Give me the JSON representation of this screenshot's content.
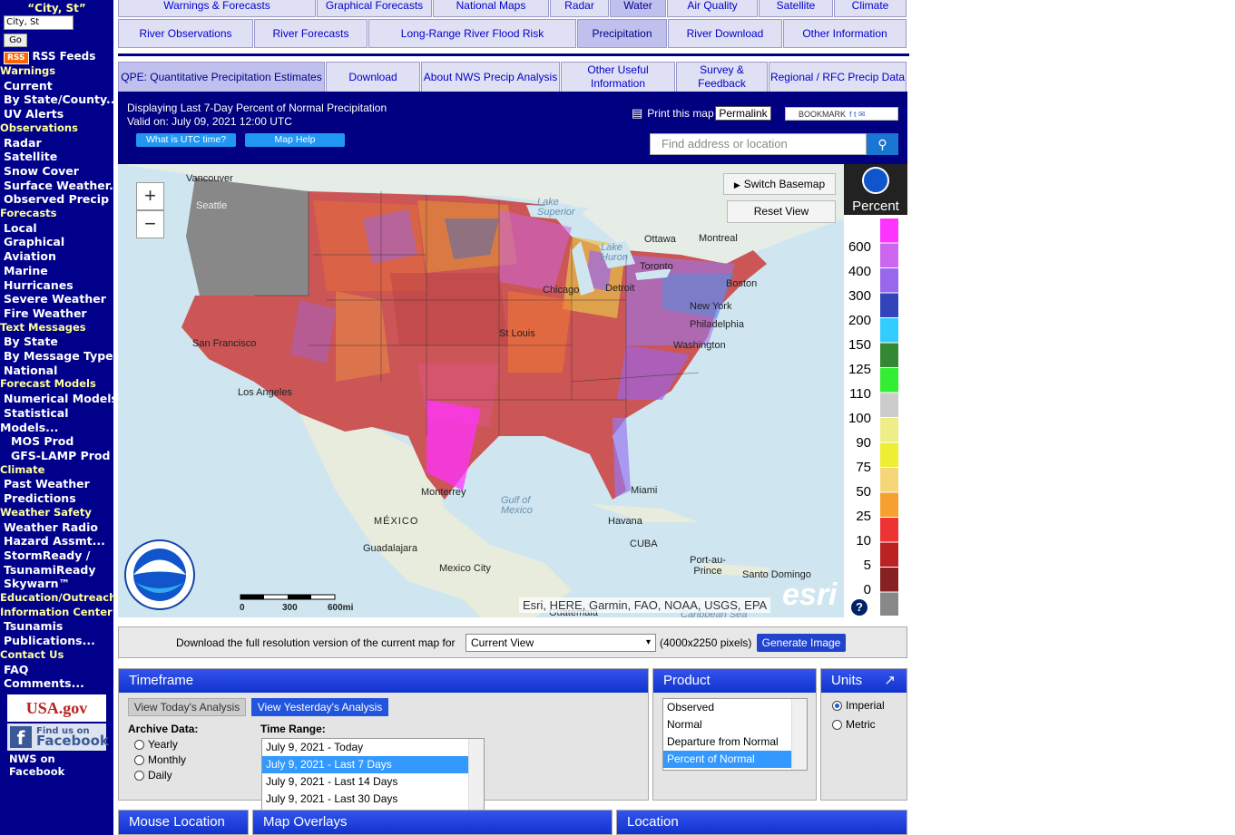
{
  "sidebar": {
    "location_title": "“City, St”",
    "location_value": "City, St",
    "go_label": "Go",
    "rss_badge": "RSS",
    "rss_label": "RSS Feeds",
    "menu": [
      {
        "type": "sec",
        "label": "Warnings"
      },
      {
        "type": "item",
        "label": "Current"
      },
      {
        "type": "item",
        "label": "By State/County..."
      },
      {
        "type": "item",
        "label": "UV Alerts"
      },
      {
        "type": "sec",
        "label": "Observations"
      },
      {
        "type": "item",
        "label": "Radar"
      },
      {
        "type": "item",
        "label": "Satellite"
      },
      {
        "type": "item",
        "label": "Snow Cover"
      },
      {
        "type": "item",
        "label": "Surface Weather..."
      },
      {
        "type": "item",
        "label": "Observed Precip"
      },
      {
        "type": "sec",
        "label": "Forecasts"
      },
      {
        "type": "item",
        "label": "Local"
      },
      {
        "type": "item",
        "label": "Graphical"
      },
      {
        "type": "item",
        "label": "Aviation"
      },
      {
        "type": "item",
        "label": "Marine"
      },
      {
        "type": "item",
        "label": "Hurricanes"
      },
      {
        "type": "item",
        "label": "Severe Weather"
      },
      {
        "type": "item",
        "label": "Fire Weather"
      },
      {
        "type": "sec",
        "label": "Text Messages"
      },
      {
        "type": "item",
        "label": "By State"
      },
      {
        "type": "item",
        "label": "By Message Type"
      },
      {
        "type": "item",
        "label": "National"
      },
      {
        "type": "sec",
        "label": "Forecast Models"
      },
      {
        "type": "item",
        "label": "Numerical Models"
      },
      {
        "type": "item",
        "label": "Statistical"
      },
      {
        "type": "item0",
        "label": "Models..."
      },
      {
        "type": "sub",
        "label": "MOS Prod"
      },
      {
        "type": "sub",
        "label": "GFS-LAMP Prod"
      },
      {
        "type": "sec",
        "label": "Climate"
      },
      {
        "type": "item",
        "label": "Past Weather"
      },
      {
        "type": "item",
        "label": "Predictions"
      },
      {
        "type": "sec",
        "label": "Weather Safety"
      },
      {
        "type": "item",
        "label": "Weather Radio"
      },
      {
        "type": "item",
        "label": "Hazard Assmt..."
      },
      {
        "type": "item",
        "label": "StormReady /"
      },
      {
        "type": "item",
        "label": "TsunamiReady"
      },
      {
        "type": "item",
        "label": "Skywarn™"
      },
      {
        "type": "sec",
        "label": "Education/Outreach"
      },
      {
        "type": "sec",
        "label": "Information Center"
      },
      {
        "type": "item",
        "label": "Tsunamis"
      },
      {
        "type": "item",
        "label": "Publications..."
      },
      {
        "type": "sec",
        "label": "Contact Us"
      },
      {
        "type": "item",
        "label": "FAQ"
      },
      {
        "type": "item",
        "label": "Comments..."
      }
    ],
    "usa_gov": "USA.gov",
    "fb_line1": "Find us on",
    "fb_line2": "Facebook",
    "fb_caption": "NWS on Facebook"
  },
  "nav_row1": [
    "Warnings & Forecasts",
    "Graphical Forecasts",
    "National Maps",
    "Radar",
    "Water",
    "Air Quality",
    "Satellite",
    "Climate"
  ],
  "nav_row2": [
    "River Observations",
    "River Forecasts",
    "Long-Range River Flood Risk",
    "Precipitation",
    "River Download",
    "Other Information"
  ],
  "nav_row3": [
    "QPE: Quantitative Precipitation Estimates",
    "Download",
    "About NWS Precip Analysis",
    "Other Useful Information",
    "Survey & Feedback",
    "Regional / RFC Precip Data"
  ],
  "header": {
    "line1": "Displaying Last 7-Day Percent of Normal Precipitation",
    "line2": "Valid on: July 09, 2021 12:00 UTC",
    "utc_btn": "What is UTC time?",
    "help_btn": "Map Help",
    "print": "Print this map",
    "permalink": "Permalink",
    "bookmark": "BOOKMARK",
    "search_placeholder": "Find address or location"
  },
  "map": {
    "switch_basemap": "Switch Basemap",
    "reset_view": "Reset View",
    "zoom_in": "+",
    "zoom_out": "−",
    "labels": [
      "Vancouver",
      "Seattle",
      "Lake Superior",
      "Ottawa",
      "Montreal",
      "Lake Huron",
      "Toronto",
      "Chicago",
      "Detroit",
      "Boston",
      "New York",
      "Philadelphia",
      "Washington",
      "St Louis",
      "San Francisco",
      "Los Angeles",
      "Monterrey",
      "Miami",
      "Havana",
      "CUBA",
      "MÉXICO",
      "Guadalajara",
      "Mexico City",
      "Port-au-Prince",
      "Santo Domingo",
      "Gulf of Mexico",
      "Guatemala",
      "Caribbean Sea"
    ],
    "attribution": "Esri, HERE, Garmin, FAO, NOAA, USGS, EPA",
    "esri": "esri",
    "scale": [
      "0",
      "300",
      "600mi"
    ]
  },
  "legend": {
    "title": "Percent",
    "values": [
      "600",
      "400",
      "300",
      "200",
      "150",
      "125",
      "110",
      "100",
      "90",
      "75",
      "50",
      "25",
      "10",
      "5",
      "0"
    ],
    "colors": [
      "#ff33ff",
      "#cc66ee",
      "#9966ee",
      "#3344bb",
      "#33ccff",
      "#338833",
      "#33ee33",
      "#cccccc",
      "#eeee88",
      "#eeee33",
      "#f5d77a",
      "#f5a030",
      "#ee3333",
      "#bb2222",
      "#882222",
      "#888888"
    ]
  },
  "download": {
    "text": "Download the full resolution version of the current map for",
    "select": "Current View",
    "size": "(4000x2250 pixels)",
    "button": "Generate Image"
  },
  "timeframe": {
    "title": "Timeframe",
    "today_btn": "View Today's Analysis",
    "yesterday_btn": "View Yesterday's Analysis",
    "archive_label": "Archive Data:",
    "archive": [
      "Yearly",
      "Monthly",
      "Daily"
    ],
    "range_label": "Time Range:",
    "ranges": [
      "July 9, 2021 - Today",
      "July 9, 2021 - Last 7 Days",
      "July 9, 2021 - Last 14 Days",
      "July 9, 2021 - Last 30 Days"
    ]
  },
  "product": {
    "title": "Product",
    "options": [
      "Observed",
      "Normal",
      "Departure from Normal",
      "Percent of Normal"
    ]
  },
  "units": {
    "title": "Units",
    "options": [
      "Imperial",
      "Metric"
    ]
  },
  "bottom": [
    "Mouse Location",
    "Map Overlays",
    "Location"
  ]
}
